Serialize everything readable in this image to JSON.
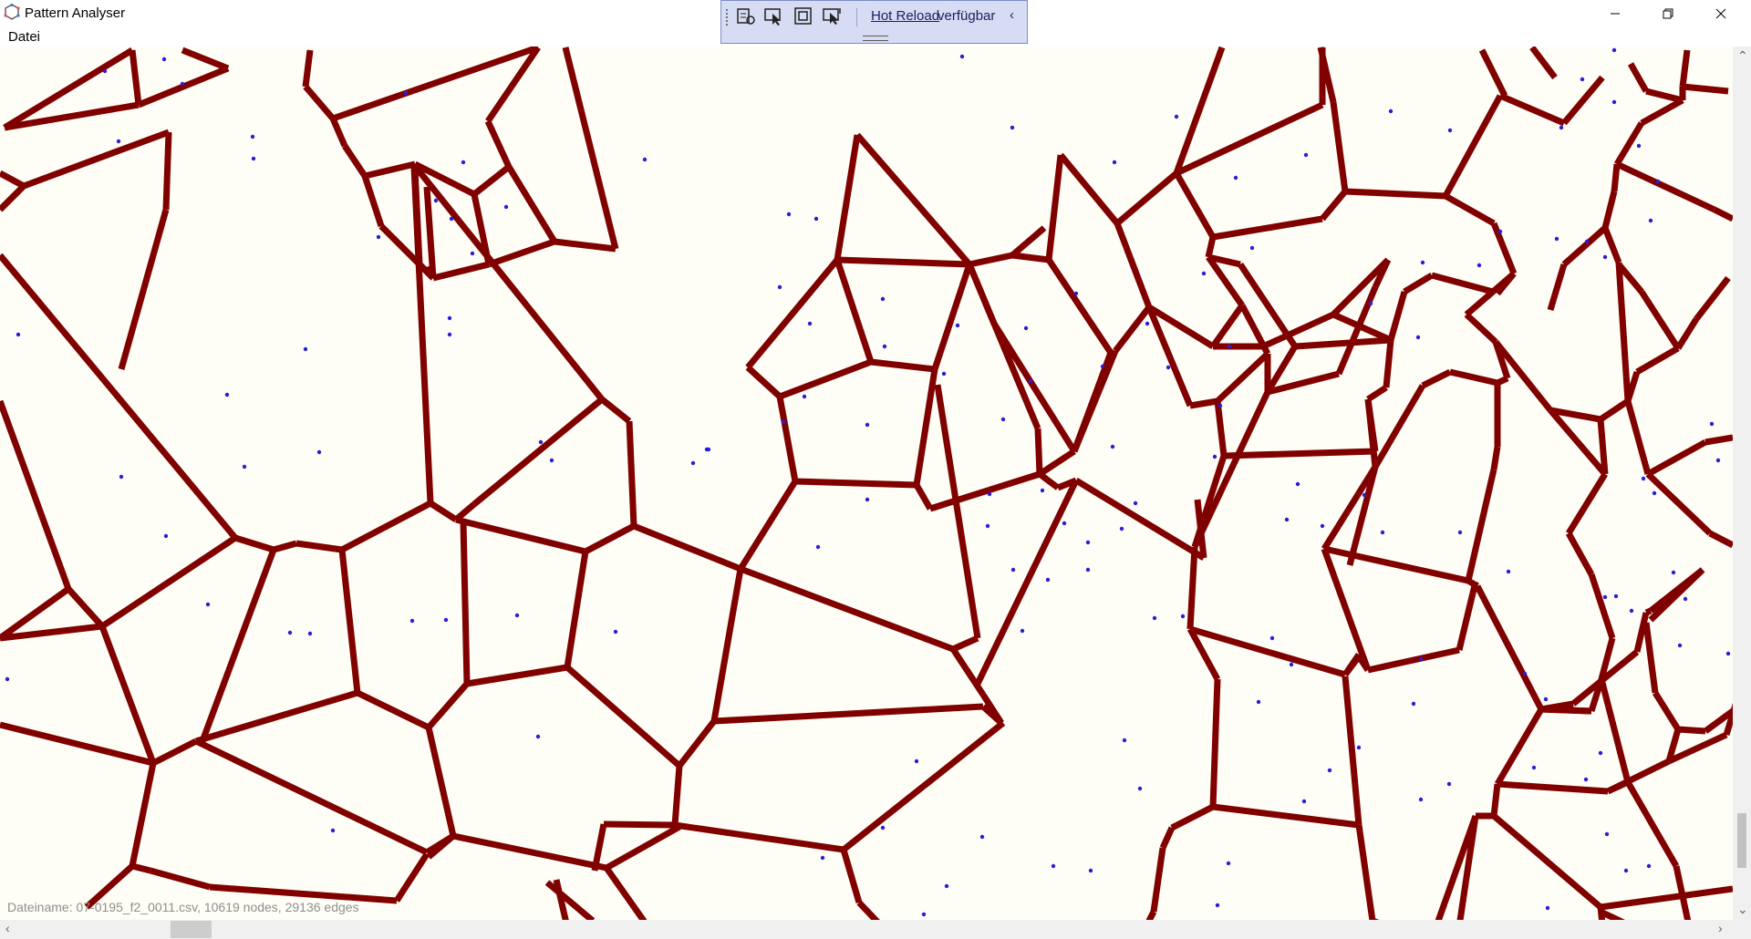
{
  "window": {
    "title": "Pattern Analyser"
  },
  "window_controls": {
    "minimize": "—",
    "restore": "❐",
    "close": "✕"
  },
  "menu": {
    "items": [
      {
        "label": "Datei"
      }
    ]
  },
  "hot_reload_bar": {
    "link": "Hot Reload",
    "text": "verfügbar"
  },
  "status": {
    "text": "Dateiname: 07-0195_f2_0011.csv, 10619 nodes, 29136 edges"
  },
  "colors": {
    "edge": "#800000",
    "node": "#2a1dd6",
    "canvas": "#fefdf6"
  },
  "scroll": {
    "horizontal_position": 0.09,
    "vertical_position": 0.9
  }
}
